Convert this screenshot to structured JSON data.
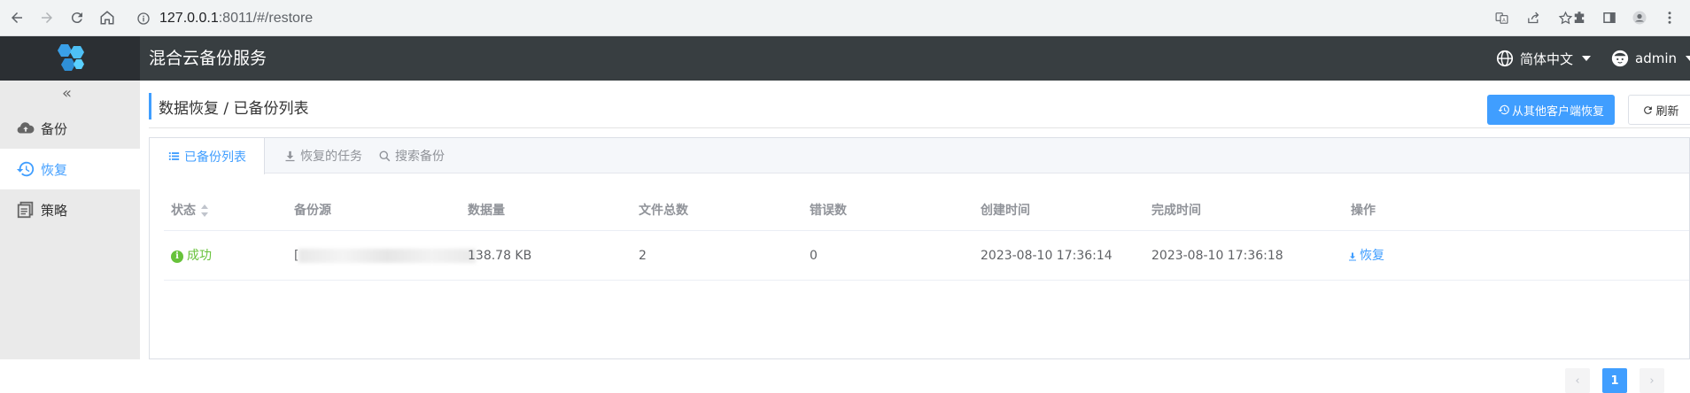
{
  "browser": {
    "url_host": "127.0.0.1",
    "url_rest": ":8011/#/restore"
  },
  "header": {
    "title": "混合云备份服务",
    "language": "简体中文",
    "user": "admin"
  },
  "sidebar": {
    "items": [
      {
        "label": "备份",
        "icon": "cloud-upload-icon"
      },
      {
        "label": "恢复",
        "icon": "history-icon",
        "active": true
      },
      {
        "label": "策略",
        "icon": "policy-icon"
      }
    ]
  },
  "main": {
    "breadcrumb": "数据恢复 / 已备份列表",
    "restore_from_other_label": "从其他客户端恢复",
    "refresh_label": "刷新",
    "tabs": [
      {
        "label": "已备份列表",
        "icon": "list-icon",
        "active": true
      },
      {
        "label": "恢复的任务",
        "icon": "download-icon"
      },
      {
        "label": "搜索备份",
        "icon": "search-icon"
      }
    ],
    "table": {
      "columns": [
        "状态",
        "备份源",
        "数据量",
        "文件总数",
        "错误数",
        "创建时间",
        "完成时间",
        "操作"
      ],
      "rows": [
        {
          "status": "成功",
          "source": "[",
          "size": "138.78 KB",
          "files": "2",
          "errors": "0",
          "created": "2023-08-10 17:36:14",
          "finished": "2023-08-10 17:36:18",
          "action": "恢复"
        }
      ]
    },
    "pagination": {
      "current": "1"
    }
  },
  "colors": {
    "primary": "#409eff",
    "success": "#67c23a",
    "header_bg": "#383e41",
    "sidebar_bg": "#eaeaea"
  }
}
